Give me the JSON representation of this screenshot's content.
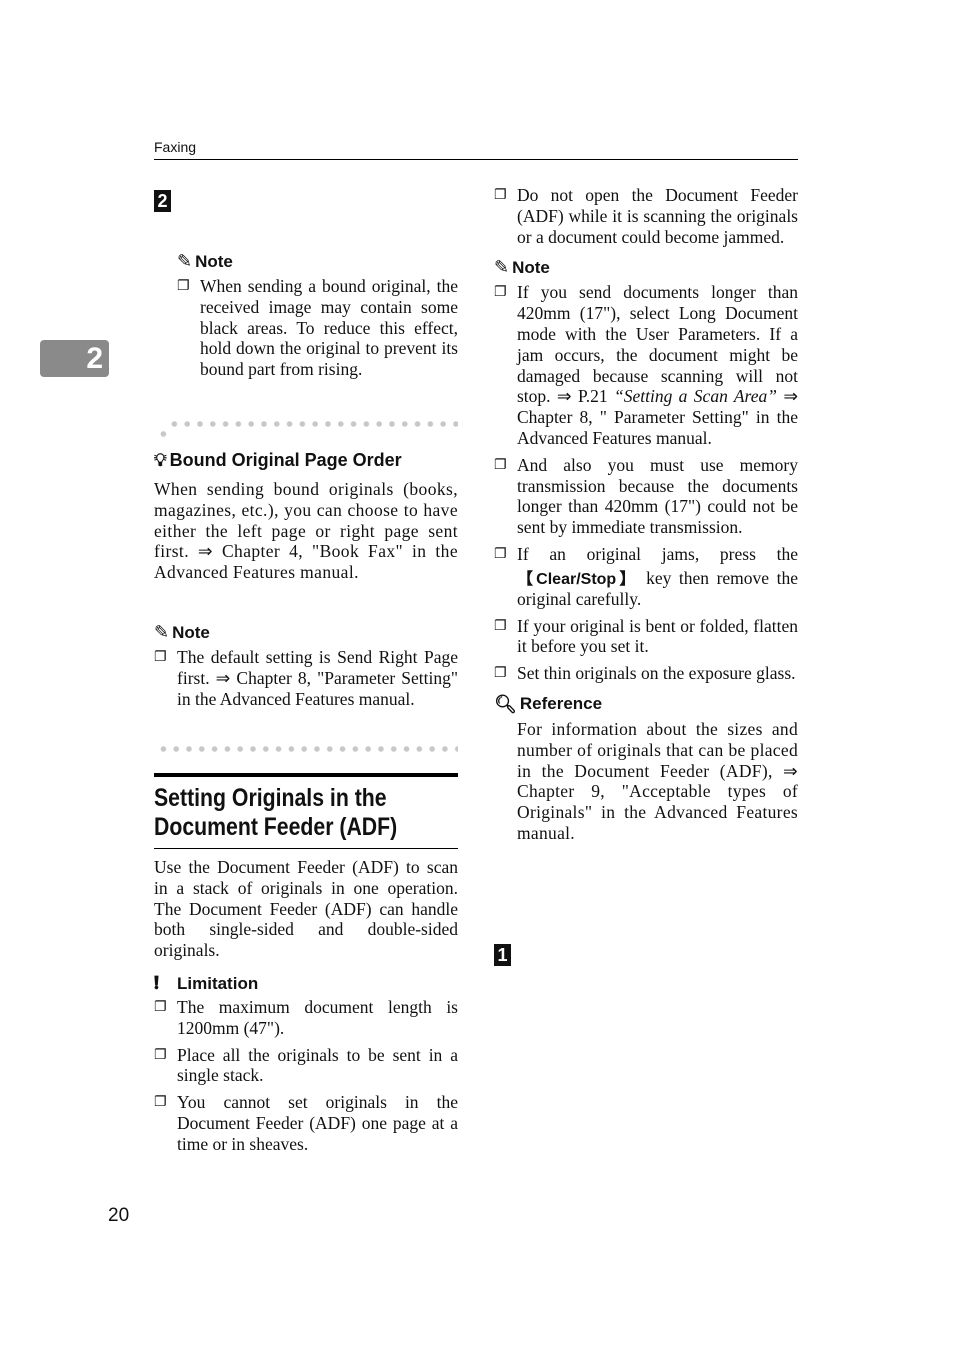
{
  "header": {
    "section": "Faxing"
  },
  "chapter_tab": "2",
  "page_number": "20",
  "left": {
    "step2": "2",
    "note1": {
      "label": "Note",
      "items": [
        "When sending a bound original, the received image may contain some black areas. To reduce this effect, hold down the original to prevent its bound part from ris­ing."
      ]
    },
    "tip": {
      "title": "Bound Original Page Order",
      "body": "When sending bound originals (books, magazines, etc.), you can choose to have either the left page or right page sent first. ⇒ Chapter 4, \"Book Fax\" in the Advanced Features manual."
    },
    "note2": {
      "label": "Note",
      "items": [
        "The default setting is Send Right Page first. ⇒ Chapter 8, \"Parame­ter Setting\" in the Advanced Fea­tures manual."
      ]
    },
    "section": {
      "title_line1": "Setting Originals in the",
      "title_line2": "Document Feeder (ADF)",
      "body": "Use the Document Feeder (ADF) to scan in a stack of originals in one op­eration. The Document Feeder (ADF) can handle both single-sided and double-sided originals."
    },
    "limitation": {
      "label": "Limitation",
      "items": [
        "The maximum document length is 1200mm (47\").",
        "Place all the originals to be sent in a single stack.",
        "You cannot set originals in the Document Feeder (ADF) one page at a time or in sheaves."
      ]
    }
  },
  "right": {
    "top_item": "Do not open the Document Feeder (ADF) while it is scanning the orig­inals or a document could become jammed.",
    "note": {
      "label": "Note",
      "item1": {
        "a": "If you send documents longer than 420mm (17\"), select Long Docu­ment mode with the User Parame­ters. If a jam occurs, the document might be damaged because scan­ning will not stop. ⇒ P.21 ",
        "italic": "“Setting a Scan Area”",
        "b": " ⇒ Chapter 8, \" Param­eter Setting\" in the Advanced Fea­tures manual."
      },
      "item2": "And also you must use memory transmission because the docu­ments longer than 420mm (17\") could not be sent by immediate transmission.",
      "item3": {
        "a": "If an original jams, press the ",
        "key": "【Clear/Stop】",
        "b": " key then remove the original carefully."
      },
      "item4": "If your original is bent or folded, flatten it before you set it.",
      "item5": "Set thin originals on the exposure glass."
    },
    "reference": {
      "label": "Reference",
      "body": "For information about the sizes and number of originals that can be placed in the Document Feeder (ADF), ⇒ Chapter 9, \"Acceptable types of Originals\" in the Ad­vanced Features manual."
    },
    "step1": "1"
  },
  "icons": {
    "note": "pencil-icon",
    "tip": "lightbulb-icon",
    "limitation": "exclamation-icon",
    "reference": "magnifier-icon",
    "bullet": "checkbox-bullet-icon"
  }
}
